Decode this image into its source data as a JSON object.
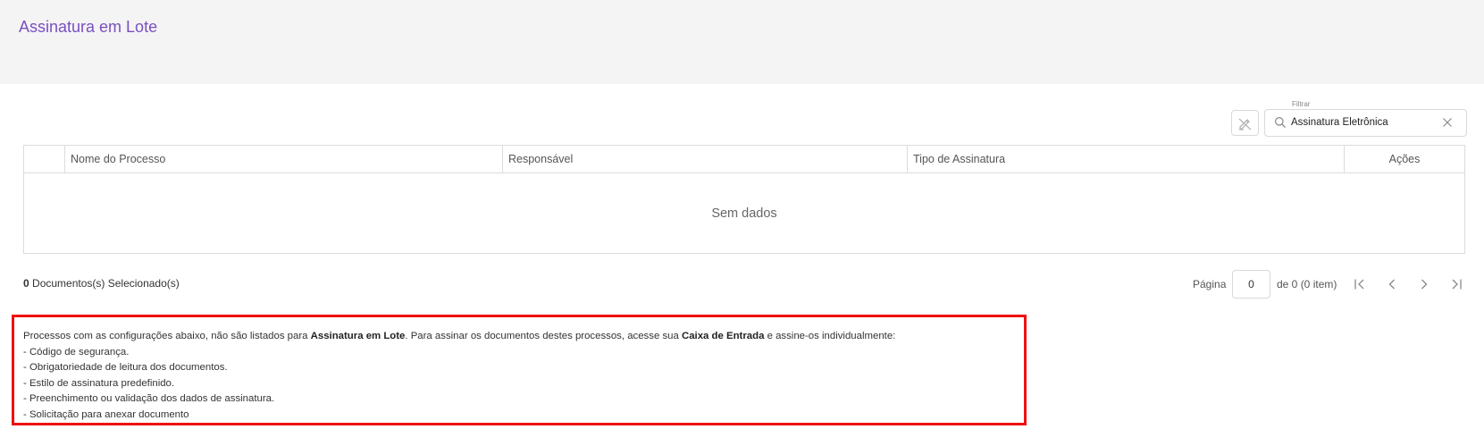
{
  "page": {
    "title": "Assinatura em Lote"
  },
  "filter": {
    "label": "Filtrar",
    "value": "Assinatura Eletrônica"
  },
  "grid": {
    "columns": {
      "name": "Nome do Processo",
      "responsible": "Responsável",
      "signature_type": "Tipo de Assinatura",
      "actions": "Ações"
    },
    "empty_message": "Sem dados"
  },
  "selection": {
    "count": "0",
    "label": "Documentos(s) Selecionado(s)"
  },
  "pager": {
    "label": "Página",
    "page": "0",
    "of_text": "de 0 (0 item)"
  },
  "info": {
    "intro_1": "Processos com as configurações abaixo, não são listados para ",
    "intro_bold_1": "Assinatura em Lote",
    "intro_2": ". Para assinar os documentos destes processos, acesse sua ",
    "intro_bold_2": "Caixa de Entrada",
    "intro_3": " e assine-os individualmente:",
    "items": [
      "- Código de segurança.",
      "- Obrigatoriedade de leitura dos documentos.",
      "- Estilo de assinatura predefinido.",
      "- Preenchimento ou validação dos dados de assinatura.",
      "- Solicitação para anexar documento"
    ]
  },
  "colors": {
    "title": "#7a4fc0",
    "header_bg": "#f4f4f5",
    "info_border": "#ee1111"
  }
}
